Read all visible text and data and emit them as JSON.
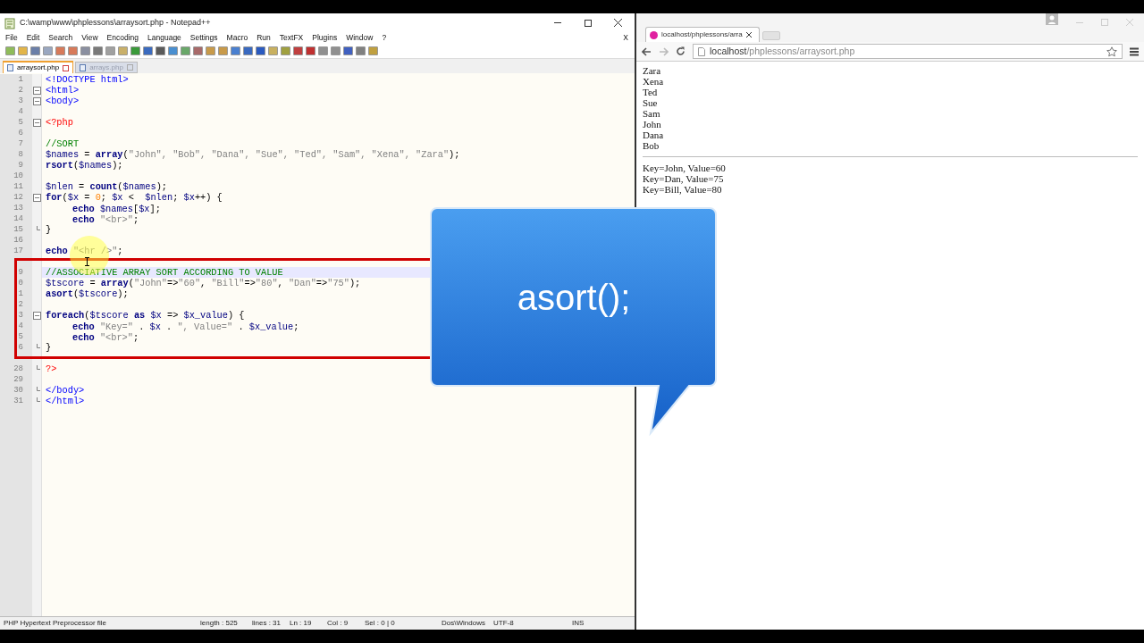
{
  "editor": {
    "title": "C:\\wamp\\www\\phplessons\\arraysort.php - Notepad++",
    "menu": [
      "File",
      "Edit",
      "Search",
      "View",
      "Encoding",
      "Language",
      "Settings",
      "Macro",
      "Run",
      "TextFX",
      "Plugins",
      "Window",
      "?"
    ],
    "menu_close": "X",
    "tabs": [
      {
        "label": "arraysort.php",
        "selected": true
      },
      {
        "label": "arrays.php",
        "selected": false
      }
    ],
    "lines": [
      {
        "number": "1",
        "current": false,
        "fold_start": false,
        "fold_end": false,
        "tokens": [
          {
            "text": "<!DOCTYPE html>",
            "kind": "tag"
          }
        ]
      },
      {
        "number": "2",
        "current": false,
        "fold_start": true,
        "fold_end": false,
        "tokens": [
          {
            "text": "<html>",
            "kind": "tag"
          }
        ]
      },
      {
        "number": "3",
        "current": false,
        "fold_start": true,
        "fold_end": false,
        "tokens": [
          {
            "text": "<body>",
            "kind": "tag"
          }
        ]
      },
      {
        "number": "4",
        "current": false,
        "fold_start": false,
        "fold_end": false
      },
      {
        "number": "5",
        "current": false,
        "fold_start": true,
        "fold_end": false,
        "tokens": [
          {
            "text": "<?php",
            "kind": "php"
          }
        ]
      },
      {
        "number": "6",
        "current": false,
        "fold_start": false,
        "fold_end": false
      },
      {
        "number": "7",
        "current": false,
        "fold_start": false,
        "fold_end": false,
        "tokens": [
          {
            "text": "//SORT",
            "kind": "cmt"
          }
        ]
      },
      {
        "number": "8",
        "current": false,
        "fold_start": false,
        "fold_end": false,
        "tokens": [
          {
            "text": "$names",
            "kind": "var"
          },
          {
            "text": " = ",
            "kind": "op"
          },
          {
            "text": "array",
            "kind": "kw"
          },
          {
            "text": "(",
            "kind": "op"
          },
          {
            "text": "\"John\", \"Bob\", \"Dana\", \"Sue\", \"Ted\", \"Sam\", \"Xena\", \"Zara\"",
            "kind": "str"
          },
          {
            "text": ");",
            "kind": "op"
          }
        ]
      },
      {
        "number": "9",
        "current": false,
        "fold_start": false,
        "fold_end": false,
        "tokens": [
          {
            "text": "rsort",
            "kind": "kw"
          },
          {
            "text": "(",
            "kind": "op"
          },
          {
            "text": "$names",
            "kind": "var"
          },
          {
            "text": ");",
            "kind": "op"
          }
        ]
      },
      {
        "number": "10",
        "current": false,
        "fold_start": false,
        "fold_end": false
      },
      {
        "number": "11",
        "current": false,
        "fold_start": false,
        "fold_end": false,
        "tokens": [
          {
            "text": "$nlen",
            "kind": "var"
          },
          {
            "text": " = ",
            "kind": "op"
          },
          {
            "text": "count",
            "kind": "kw"
          },
          {
            "text": "(",
            "kind": "op"
          },
          {
            "text": "$names",
            "kind": "var"
          },
          {
            "text": ");",
            "kind": "op"
          }
        ]
      },
      {
        "number": "12",
        "current": false,
        "fold_start": true,
        "fold_end": false,
        "tokens": [
          {
            "text": "for",
            "kind": "kw"
          },
          {
            "text": "(",
            "kind": "op"
          },
          {
            "text": "$x",
            "kind": "var"
          },
          {
            "text": " = ",
            "kind": "op"
          },
          {
            "text": "0",
            "kind": "num"
          },
          {
            "text": "; ",
            "kind": "op"
          },
          {
            "text": "$x",
            "kind": "var"
          },
          {
            "text": " <  ",
            "kind": "op"
          },
          {
            "text": "$nlen",
            "kind": "var"
          },
          {
            "text": "; ",
            "kind": "op"
          },
          {
            "text": "$x",
            "kind": "var"
          },
          {
            "text": "++) {",
            "kind": "op"
          }
        ]
      },
      {
        "number": "13",
        "current": false,
        "fold_start": false,
        "fold_end": false,
        "indent": true,
        "tokens": [
          {
            "text": "echo ",
            "kind": "kw"
          },
          {
            "text": "$names",
            "kind": "var"
          },
          {
            "text": "[",
            "kind": "op"
          },
          {
            "text": "$x",
            "kind": "var"
          },
          {
            "text": "];",
            "kind": "op"
          }
        ]
      },
      {
        "number": "14",
        "current": false,
        "fold_start": false,
        "fold_end": false,
        "indent": true,
        "tokens": [
          {
            "text": "echo ",
            "kind": "kw"
          },
          {
            "text": "\"<br>\"",
            "kind": "str"
          },
          {
            "text": ";",
            "kind": "op"
          }
        ]
      },
      {
        "number": "15",
        "current": false,
        "fold_start": false,
        "fold_end": true,
        "tokens": [
          {
            "text": "}",
            "kind": "op"
          }
        ]
      },
      {
        "number": "16",
        "current": false,
        "fold_start": false,
        "fold_end": false
      },
      {
        "number": "17",
        "current": false,
        "fold_start": false,
        "fold_end": false,
        "tokens": [
          {
            "text": "echo ",
            "kind": "kw"
          },
          {
            "text": "\"<hr />\"",
            "kind": "str"
          },
          {
            "text": ";",
            "kind": "op"
          }
        ]
      },
      {
        "current": false
      },
      {
        "number": "9",
        "current": true,
        "fold_start": false,
        "fold_end": false,
        "tokens": [
          {
            "text": "//ASSOCIATIVE ARRAY SORT ACCORDING TO VALUE",
            "kind": "cmt"
          }
        ]
      },
      {
        "number": "0",
        "current": false,
        "fold_start": false,
        "fold_end": false,
        "tokens": [
          {
            "text": "$tscore",
            "kind": "var"
          },
          {
            "text": " = ",
            "kind": "op"
          },
          {
            "text": "array",
            "kind": "kw"
          },
          {
            "text": "(",
            "kind": "op"
          },
          {
            "text": "\"John\"",
            "kind": "str"
          },
          {
            "text": "=>",
            "kind": "op"
          },
          {
            "text": "\"60\"",
            "kind": "str"
          },
          {
            "text": ", ",
            "kind": "op"
          },
          {
            "text": "\"Bill\"",
            "kind": "str"
          },
          {
            "text": "=>",
            "kind": "op"
          },
          {
            "text": "\"80\"",
            "kind": "str"
          },
          {
            "text": ", ",
            "kind": "op"
          },
          {
            "text": "\"Dan\"",
            "kind": "str"
          },
          {
            "text": "=>",
            "kind": "op"
          },
          {
            "text": "\"75\"",
            "kind": "str"
          },
          {
            "text": ");",
            "kind": "op"
          }
        ]
      },
      {
        "number": "1",
        "current": false,
        "fold_start": false,
        "fold_end": false,
        "tokens": [
          {
            "text": "asort",
            "kind": "kw"
          },
          {
            "text": "(",
            "kind": "op"
          },
          {
            "text": "$tscore",
            "kind": "var"
          },
          {
            "text": ");",
            "kind": "op"
          }
        ]
      },
      {
        "number": "2",
        "current": false,
        "fold_start": false,
        "fold_end": false
      },
      {
        "number": "3",
        "current": false,
        "fold_start": true,
        "fold_end": false,
        "tokens": [
          {
            "text": "foreach",
            "kind": "kw"
          },
          {
            "text": "(",
            "kind": "op"
          },
          {
            "text": "$tscore ",
            "kind": "var"
          },
          {
            "text": "as ",
            "kind": "kw"
          },
          {
            "text": "$x",
            "kind": "var"
          },
          {
            "text": " => ",
            "kind": "op"
          },
          {
            "text": "$x_value",
            "kind": "var"
          },
          {
            "text": ") {",
            "kind": "op"
          }
        ]
      },
      {
        "number": "4",
        "current": false,
        "fold_start": false,
        "fold_end": false,
        "indent": true,
        "tokens": [
          {
            "text": "echo ",
            "kind": "kw"
          },
          {
            "text": "\"Key=\"",
            "kind": "str"
          },
          {
            "text": " . ",
            "kind": "op"
          },
          {
            "text": "$x",
            "kind": "var"
          },
          {
            "text": " . ",
            "kind": "op"
          },
          {
            "text": "\", Value=\"",
            "kind": "str"
          },
          {
            "text": " . ",
            "kind": "op"
          },
          {
            "text": "$x_value",
            "kind": "var"
          },
          {
            "text": ";",
            "kind": "op"
          }
        ]
      },
      {
        "number": "5",
        "current": false,
        "fold_start": false,
        "fold_end": false,
        "indent": true,
        "tokens": [
          {
            "text": "echo ",
            "kind": "kw"
          },
          {
            "text": "\"<br>\"",
            "kind": "str"
          },
          {
            "text": ";",
            "kind": "op"
          }
        ]
      },
      {
        "number": "6",
        "current": false,
        "fold_start": false,
        "fold_end": true,
        "tokens": [
          {
            "text": "}",
            "kind": "op"
          }
        ]
      },
      {
        "current": false
      },
      {
        "number": "28",
        "current": false,
        "fold_start": false,
        "fold_end": true,
        "tokens": [
          {
            "text": "?>",
            "kind": "php"
          }
        ]
      },
      {
        "number": "29",
        "current": false,
        "fold_start": false,
        "fold_end": false
      },
      {
        "number": "30",
        "current": false,
        "fold_start": false,
        "fold_end": true,
        "tokens": [
          {
            "text": "</body>",
            "kind": "tag"
          }
        ]
      },
      {
        "number": "31",
        "current": false,
        "fold_start": false,
        "fold_end": true,
        "tokens": [
          {
            "text": "</html>",
            "kind": "tag"
          }
        ]
      }
    ],
    "status_bar": [
      {
        "text": "PHP Hypertext Preprocessor file",
        "kind": "wide"
      },
      {
        "text": "length : 525",
        "kind": "narrow"
      },
      {
        "text": "lines : 31",
        "kind": "tiny"
      },
      {
        "text": "Ln : 19",
        "kind": "tiny"
      },
      {
        "text": "Col : 9",
        "kind": "tiny"
      },
      {
        "text": "Sel : 0 | 0",
        "kind": "gap"
      },
      {
        "text": "Dos\\Windows",
        "kind": "narrow"
      },
      {
        "text": "UTF-8",
        "kind": "gap2"
      },
      {
        "text": "INS",
        "kind": "tiny"
      }
    ]
  },
  "callout": {
    "text": "asort();"
  },
  "browser": {
    "tab_title": "localhost/phplessons/arra",
    "url_host": "localhost",
    "url_path": "/phplessons/arraysort.php",
    "names": [
      "Zara",
      "Xena",
      "Ted",
      "Sue",
      "Sam",
      "John",
      "Dana",
      "Bob"
    ],
    "results": [
      "Key=John, Value=60",
      "Key=Dan, Value=75",
      "Key=Bill, Value=80"
    ]
  }
}
